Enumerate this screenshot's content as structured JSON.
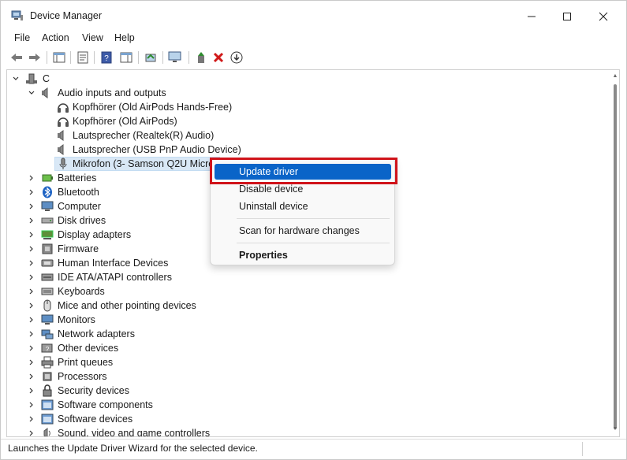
{
  "window": {
    "title": "Device Manager",
    "accent": "#0a64c8",
    "highlight_box_color": "#d0131a"
  },
  "menubar": {
    "items": [
      "File",
      "Action",
      "View",
      "Help"
    ]
  },
  "toolbar": {
    "buttons": [
      "back-icon",
      "forward-icon",
      "show-hide-console-tree-icon",
      "properties-icon",
      "help-icon",
      "action-pane-icon",
      "update-driver-icon",
      "scan-hardware-icon",
      "add-legacy-hardware-icon",
      "uninstall-icon",
      "disable-icon"
    ]
  },
  "tree": {
    "root": "C",
    "audio_category": "Audio inputs and outputs",
    "audio_children": [
      "Kopfhörer (Old AirPods Hands-Free)",
      "Kopfhörer (Old AirPods)",
      "Lautsprecher (Realtek(R) Audio)",
      "Lautsprecher (USB PnP Audio Device)",
      "Mikrofon (3- Samson Q2U Micro"
    ],
    "categories": [
      "Batteries",
      "Bluetooth",
      "Computer",
      "Disk drives",
      "Display adapters",
      "Firmware",
      "Human Interface Devices",
      "IDE ATA/ATAPI controllers",
      "Keyboards",
      "Mice and other pointing devices",
      "Monitors",
      "Network adapters",
      "Other devices",
      "Print queues",
      "Processors",
      "Security devices",
      "Software components",
      "Software devices",
      "Sound, video and game controllers"
    ]
  },
  "context_menu": {
    "update_driver": "Update driver",
    "disable_device": "Disable device",
    "uninstall_device": "Uninstall device",
    "scan_hardware": "Scan for hardware changes",
    "properties": "Properties"
  },
  "status": {
    "text": "Launches the Update Driver Wizard for the selected device."
  }
}
